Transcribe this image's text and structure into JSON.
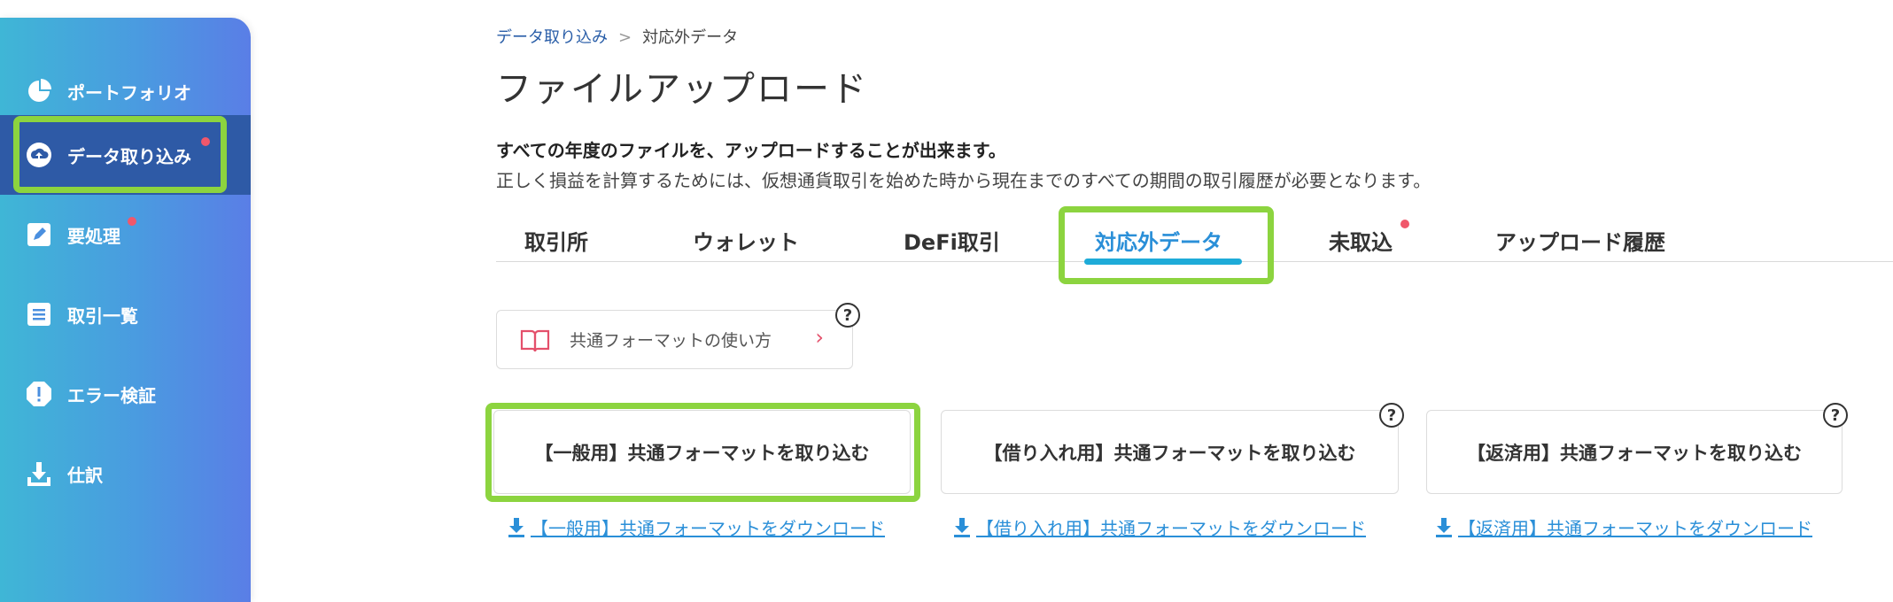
{
  "sidebar": {
    "items": [
      {
        "label": "ポートフォリオ",
        "icon": "pie-chart-icon"
      },
      {
        "label": "データ取り込み",
        "icon": "cloud-upload-icon",
        "badge": true
      },
      {
        "label": "要処理",
        "icon": "edit-icon",
        "badge": true
      },
      {
        "label": "取引一覧",
        "icon": "list-icon"
      },
      {
        "label": "エラー検証",
        "icon": "alert-icon"
      },
      {
        "label": "仕訳",
        "icon": "download-icon"
      }
    ]
  },
  "breadcrumb": {
    "parent": "データ取り込み",
    "separator": ">",
    "current": "対応外データ"
  },
  "page": {
    "title": "ファイルアップロード",
    "description_bold": "すべての年度のファイルを、アップロードすることが出来ます。",
    "description": "正しく損益を計算するためには、仮想通貨取引を始めた時から現在までのすべての期間の取引履歴が必要となります。"
  },
  "tabs": [
    {
      "label": "取引所"
    },
    {
      "label": "ウォレット"
    },
    {
      "label": "DeFi取引"
    },
    {
      "label": "対応外データ",
      "active": true
    },
    {
      "label": "未取込",
      "badge": true
    },
    {
      "label": "アップロード履歴"
    }
  ],
  "guide": {
    "label": "共通フォーマットの使い方",
    "help": "?"
  },
  "imports": [
    {
      "label": "【一般用】共通フォーマットを取り込む",
      "download": "【一般用】共通フォーマットをダウンロード"
    },
    {
      "label": "【借り入れ用】共通フォーマットを取り込む",
      "download": "【借り入れ用】共通フォーマットをダウンロード",
      "help": "?"
    },
    {
      "label": "【返済用】共通フォーマットを取り込む",
      "download": "【返済用】共通フォーマットをダウンロード",
      "help": "?"
    }
  ],
  "colors": {
    "accent": "#2a8fd8",
    "highlight": "#8cd43f",
    "badge": "#f0576b",
    "sidebar_active": "#2e5aa6"
  }
}
